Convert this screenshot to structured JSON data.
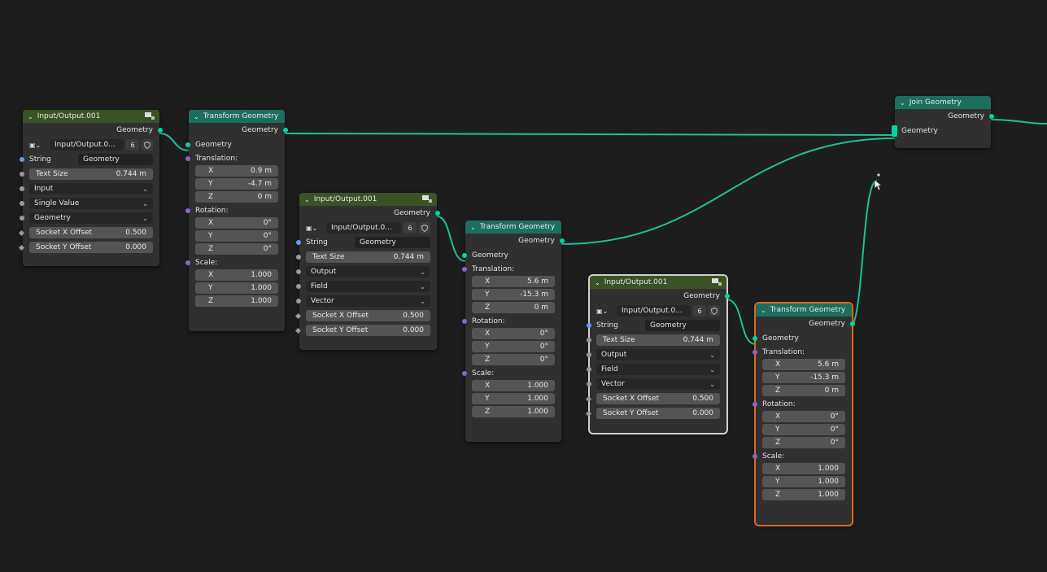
{
  "colors": {
    "wire": "#1fbf95",
    "io_header": "#3a5225",
    "transform_header": "#1c6e5f",
    "join_header": "#1c6e5f",
    "selected_outline": "#e0661f"
  },
  "io_nodes": [
    {
      "title": "Input/Output.001",
      "output": "Geometry",
      "datablock": "Input/Output.0...",
      "users": "6",
      "string_label": "String",
      "string_value": "Geometry",
      "text_size_label": "Text Size",
      "text_size_value": "0.744 m",
      "enums": [
        "Input",
        "Single Value",
        "Geometry"
      ],
      "socket_x_label": "Socket X Offset",
      "socket_x_value": "0.500",
      "socket_y_label": "Socket Y Offset",
      "socket_y_value": "0.000"
    },
    {
      "title": "Input/Output.001",
      "output": "Geometry",
      "datablock": "Input/Output.0...",
      "users": "6",
      "string_label": "String",
      "string_value": "Geometry",
      "text_size_label": "Text Size",
      "text_size_value": "0.744 m",
      "enums": [
        "Output",
        "Field",
        "Vector"
      ],
      "socket_x_label": "Socket X Offset",
      "socket_x_value": "0.500",
      "socket_y_label": "Socket Y Offset",
      "socket_y_value": "0.000"
    },
    {
      "title": "Input/Output.001",
      "output": "Geometry",
      "datablock": "Input/Output.0...",
      "users": "6",
      "string_label": "String",
      "string_value": "Geometry",
      "text_size_label": "Text Size",
      "text_size_value": "0.744 m",
      "enums": [
        "Output",
        "Field",
        "Vector"
      ],
      "socket_x_label": "Socket X Offset",
      "socket_x_value": "0.500",
      "socket_y_label": "Socket Y Offset",
      "socket_y_value": "0.000"
    }
  ],
  "transform_nodes": [
    {
      "title": "Transform Geometry",
      "output": "Geometry",
      "input": "Geometry",
      "translation_label": "Translation:",
      "translation": [
        [
          "X",
          "0.9 m"
        ],
        [
          "Y",
          "-4.7 m"
        ],
        [
          "Z",
          "0 m"
        ]
      ],
      "rotation_label": "Rotation:",
      "rotation": [
        [
          "X",
          "0°"
        ],
        [
          "Y",
          "0°"
        ],
        [
          "Z",
          "0°"
        ]
      ],
      "scale_label": "Scale:",
      "scale": [
        [
          "X",
          "1.000"
        ],
        [
          "Y",
          "1.000"
        ],
        [
          "Z",
          "1.000"
        ]
      ]
    },
    {
      "title": "Transform Geometry",
      "output": "Geometry",
      "input": "Geometry",
      "translation_label": "Translation:",
      "translation": [
        [
          "X",
          "5.6 m"
        ],
        [
          "Y",
          "-15.3 m"
        ],
        [
          "Z",
          "0 m"
        ]
      ],
      "rotation_label": "Rotation:",
      "rotation": [
        [
          "X",
          "0°"
        ],
        [
          "Y",
          "0°"
        ],
        [
          "Z",
          "0°"
        ]
      ],
      "scale_label": "Scale:",
      "scale": [
        [
          "X",
          "1.000"
        ],
        [
          "Y",
          "1.000"
        ],
        [
          "Z",
          "1.000"
        ]
      ]
    },
    {
      "title": "Transform Geometry",
      "output": "Geometry",
      "input": "Geometry",
      "translation_label": "Translation:",
      "translation": [
        [
          "X",
          "5.6 m"
        ],
        [
          "Y",
          "-15.3 m"
        ],
        [
          "Z",
          "0 m"
        ]
      ],
      "rotation_label": "Rotation:",
      "rotation": [
        [
          "X",
          "0°"
        ],
        [
          "Y",
          "0°"
        ],
        [
          "Z",
          "0°"
        ]
      ],
      "scale_label": "Scale:",
      "scale": [
        [
          "X",
          "1.000"
        ],
        [
          "Y",
          "1.000"
        ],
        [
          "Z",
          "1.000"
        ]
      ]
    }
  ],
  "join": {
    "title": "Join Geometry",
    "output": "Geometry",
    "input": "Geometry"
  }
}
